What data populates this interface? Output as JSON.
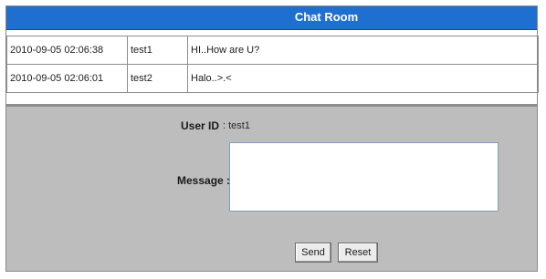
{
  "header": {
    "title": "Chat Room"
  },
  "messages": [
    {
      "time": "2010-09-05 02:06:38",
      "user": "test1",
      "text": "HI..How are U?"
    },
    {
      "time": "2010-09-05 02:06:01",
      "user": "test2",
      "text": "Halo..>.<"
    }
  ],
  "form": {
    "userid_label": "User ID",
    "userid_value": ": test1",
    "message_label": "Message :",
    "message_value": "",
    "send_label": "Send",
    "reset_label": "Reset"
  },
  "colors": {
    "title_bar": "#1e6fd0",
    "panel_bg": "#bdbdbd"
  }
}
